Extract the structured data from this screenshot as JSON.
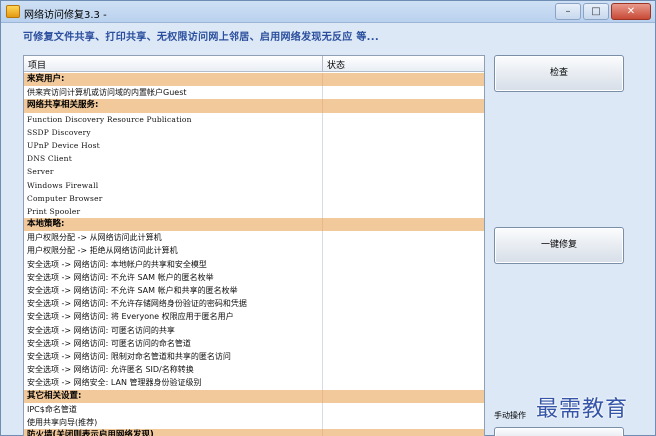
{
  "window": {
    "title": "网络访问修复3.3 -",
    "controls": {
      "minimize": "–",
      "maximize": "□",
      "close": "✕"
    }
  },
  "subtitle": "可修复文件共享、打印共享、无权限访问网上邻居、启用网络发现无反应   等...",
  "list": {
    "columns": {
      "item": "项目",
      "status": "状态"
    },
    "rows": [
      {
        "text": "来宾用户:",
        "type": "cat"
      },
      {
        "text": "供来宾访问计算机或访问域的内置帐户Guest",
        "type": "item"
      },
      {
        "text": "网络共享相关服务:",
        "type": "cat"
      },
      {
        "text": "Function Discovery Resource Publication",
        "type": "mono"
      },
      {
        "text": "SSDP Discovery",
        "type": "mono"
      },
      {
        "text": "UPnP Device Host",
        "type": "mono"
      },
      {
        "text": "DNS Client",
        "type": "mono"
      },
      {
        "text": "Server",
        "type": "mono"
      },
      {
        "text": "Windows Firewall",
        "type": "mono"
      },
      {
        "text": "Computer Browser",
        "type": "mono"
      },
      {
        "text": "Print Spooler",
        "type": "mono"
      },
      {
        "text": "本地策略:",
        "type": "cat"
      },
      {
        "text": "用户权限分配 -> 从网络访问此计算机",
        "type": "item"
      },
      {
        "text": "用户权限分配 -> 拒绝从网络访问此计算机",
        "type": "item"
      },
      {
        "text": "安全选项 -> 网络访问: 本地帐户的共享和安全模型",
        "type": "item"
      },
      {
        "text": "安全选项 -> 网络访问: 不允许 SAM 帐户的匿名枚举",
        "type": "item"
      },
      {
        "text": "安全选项 -> 网络访问: 不允许 SAM 帐户和共享的匿名枚举",
        "type": "item"
      },
      {
        "text": "安全选项 -> 网络访问: 不允许存储网络身份验证的密码和凭据",
        "type": "item"
      },
      {
        "text": "安全选项 -> 网络访问: 将 Everyone 权限应用于匿名用户",
        "type": "item"
      },
      {
        "text": "安全选项 -> 网络访问: 可匿名访问的共享",
        "type": "item"
      },
      {
        "text": "安全选项 -> 网络访问: 可匿名访问的命名管道",
        "type": "item"
      },
      {
        "text": "安全选项 -> 网络访问: 限制对命名管道和共享的匿名访问",
        "type": "item"
      },
      {
        "text": "安全选项 -> 网络访问: 允许匿名 SID/名称转换",
        "type": "item"
      },
      {
        "text": "安全选项 -> 网络安全: LAN 管理器身份验证级别",
        "type": "item"
      },
      {
        "text": "其它相关设置:",
        "type": "cat"
      },
      {
        "text": "IPC$命名管道",
        "type": "item"
      },
      {
        "text": "使用共享向导(推荐)",
        "type": "item"
      },
      {
        "text": "防火墙(关闭则表示启用网络发现)",
        "type": "cat"
      }
    ]
  },
  "buttons": {
    "check": "检查",
    "repair": "一键修复",
    "bottom": ""
  },
  "manual_label": "手动操作",
  "watermark": "最需教育"
}
